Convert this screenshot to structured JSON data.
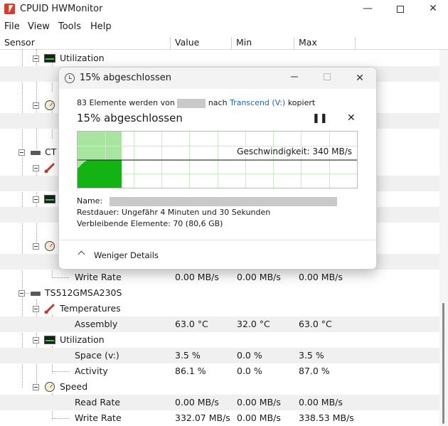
{
  "window": {
    "title": "CPUID HWMonitor",
    "minimize": "—",
    "close": "✕"
  },
  "menu": [
    "File",
    "View",
    "Tools",
    "Help"
  ],
  "columns": [
    "Sensor",
    "Value",
    "Min",
    "Max"
  ],
  "tree": {
    "utilization_1": "Utilization",
    "drive_partial": "CT",
    "write_rate_prev": {
      "label": "Write Rate",
      "value": "0.00 MB/s",
      "min": "0.00 MB/s",
      "max": "0.00 MB/s"
    },
    "drive": "TS512GMSA230S",
    "temperatures": "Temperatures",
    "assembly": {
      "label": "Assembly",
      "value": "63.0 °C",
      "min": "32.0 °C",
      "max": "63.0 °C"
    },
    "utilization": "Utilization",
    "space": {
      "label": "Space (v:)",
      "value": "3.5 %",
      "min": "0.0 %",
      "max": "3.5 %"
    },
    "activity": {
      "label": "Activity",
      "value": "86.1 %",
      "min": "0.0 %",
      "max": "87.0 %"
    },
    "speed": "Speed",
    "read_rate": {
      "label": "Read Rate",
      "value": "0.00 MB/s",
      "min": "0.00 MB/s",
      "max": "0.00 MB/s"
    },
    "write_rate": {
      "label": "Write Rate",
      "value": "332.07 MB/s",
      "min": "0.00 MB/s",
      "max": "338.53 MB/s"
    }
  },
  "dialog": {
    "title": "15% abgeschlossen",
    "close": "✕",
    "desc_prefix": "83 Elemente werden von",
    "desc_mid": "nach",
    "desc_link": "Transcend (V:)",
    "desc_suffix": "kopiert",
    "progress_title": "15% abgeschlossen",
    "pause": "❚❚",
    "stop": "✕",
    "speed_label": "Geschwindigkeit: 340 MB/s",
    "progress_fraction": 0.15,
    "name_label": "Name:",
    "remaining_label": "Restdauer:",
    "remaining_value": "Ungefähr 4 Minuten und 30 Sekunden",
    "items_label": "Verbleibende Elemente:",
    "items_value": "70 (80,6 GB)",
    "less_details": "Weniger Details",
    "colors": {
      "progress_fill": "#a8e6a0",
      "speed_area": "#12b312",
      "accent": "#1e64b4"
    }
  }
}
